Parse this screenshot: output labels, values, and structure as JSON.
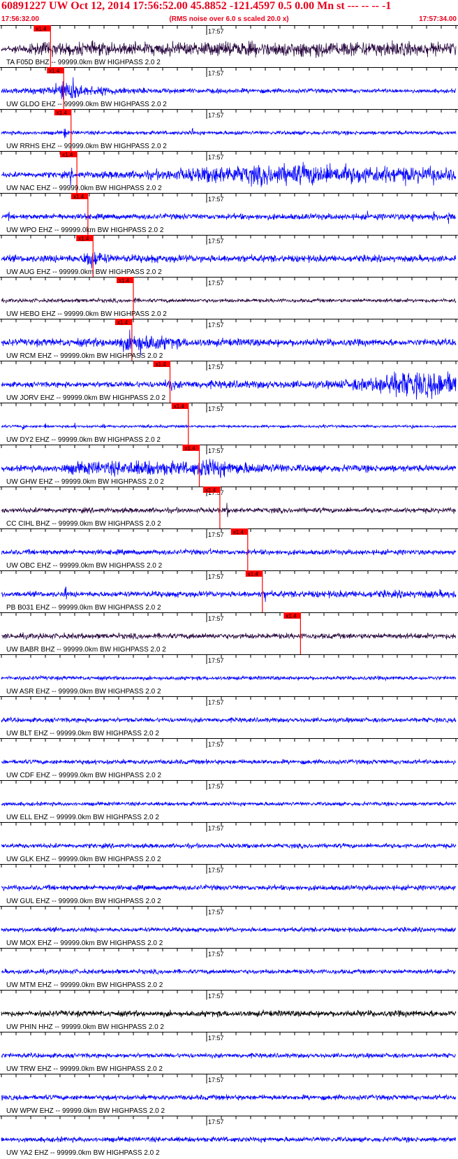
{
  "header": {
    "title": "60891227 UW Oct 12, 2014 17:56:52.00   45.8852 -121.4597  0.5 0.00 Mn st --- -- --  -1",
    "start_time": "17:56:32.00",
    "end_time": "17:57:34.00",
    "note": "(RMS noise over 6.0 s scaled 20.0 x)"
  },
  "colors": {
    "title": "#e8001c",
    "trace_blue": "#0000ff",
    "trace_dark": "#2a0a40",
    "trace_black": "#000000",
    "pick_red": "#ff0000",
    "axis": "#000000"
  },
  "chart_data": {
    "type": "seismogram",
    "x_unit": "time (UTC, 2014-10-12)",
    "x_range": [
      "17:56:32.00",
      "17:57:34.00"
    ],
    "minute_label": "17:57",
    "minute_tick": "17:57:00",
    "tick_interval_s": 2,
    "filter": "BW  HIGHPASS  2.0  2",
    "pick_label": "x1.4",
    "traces": [
      {
        "label": "TA F05D BHZ -- 99999.0km BW  HIGHPASS  2.0  2",
        "pick": "17:56:38.7",
        "color": "dark",
        "envelope": [
          [
            0,
            0.2
          ],
          [
            3,
            0.4
          ],
          [
            6,
            0.5
          ],
          [
            20,
            0.5
          ],
          [
            35,
            0.55
          ],
          [
            45,
            0.6
          ],
          [
            55,
            0.55
          ],
          [
            62,
            0.5
          ]
        ],
        "spikes": [
          [
            6.5,
            0.8
          ],
          [
            30,
            0.6
          ],
          [
            48,
            0.7
          ]
        ]
      },
      {
        "label": "UW GLDO EHZ -- 99999.0km BW  HIGHPASS  2.0  2",
        "pick": "17:56:40.5",
        "color": "blue",
        "envelope": [
          [
            0,
            0.15
          ],
          [
            7,
            0.3
          ],
          [
            8,
            0.8
          ],
          [
            10,
            0.9
          ],
          [
            11,
            0.4
          ],
          [
            20,
            0.2
          ],
          [
            62,
            0.15
          ]
        ],
        "spikes": [
          [
            8,
            0.8
          ]
        ]
      },
      {
        "label": "UW RRHS EHZ -- 99999.0km BW  HIGHPASS  2.0  2",
        "pick": "17:56:41.5",
        "color": "blue",
        "envelope": [
          [
            0,
            0.15
          ],
          [
            62,
            0.15
          ]
        ],
        "spikes": [
          [
            8.7,
            0.9
          ],
          [
            26,
            0.6
          ],
          [
            32,
            0.4
          ],
          [
            40,
            0.3
          ],
          [
            46,
            0.3
          ]
        ]
      },
      {
        "label": "UW NAC EHZ -- 99999.0km BW  HIGHPASS  2.0  2",
        "pick": "17:56:42.3",
        "color": "blue",
        "envelope": [
          [
            0,
            0.2
          ],
          [
            10,
            0.25
          ],
          [
            20,
            0.35
          ],
          [
            25,
            0.5
          ],
          [
            30,
            0.7
          ],
          [
            40,
            0.85
          ],
          [
            50,
            0.7
          ],
          [
            60,
            0.6
          ],
          [
            62,
            0.5
          ]
        ],
        "spikes": [
          [
            9.5,
            0.9
          ]
        ]
      },
      {
        "label": "UW WPO EHZ -- 99999.0km BW  HIGHPASS  2.0  2",
        "pick": "17:56:43.8",
        "color": "blue",
        "envelope": [
          [
            0,
            0.2
          ],
          [
            62,
            0.25
          ]
        ],
        "spikes": [
          [
            1,
            0.4
          ],
          [
            8,
            0.5
          ],
          [
            11.5,
            0.9
          ],
          [
            25,
            0.4
          ],
          [
            50,
            0.5
          ],
          [
            56,
            0.9
          ],
          [
            59,
            0.7
          ],
          [
            61,
            0.9
          ]
        ]
      },
      {
        "label": "UW AUG EHZ -- 99999.0km BW  HIGHPASS  2.0  2",
        "pick": "17:56:44.5",
        "color": "blue",
        "envelope": [
          [
            0,
            0.25
          ],
          [
            11,
            0.3
          ],
          [
            12,
            0.9
          ],
          [
            13,
            0.6
          ],
          [
            15,
            0.3
          ],
          [
            62,
            0.25
          ]
        ],
        "spikes": [
          [
            20.5,
            0.6
          ]
        ]
      },
      {
        "label": "UW HEBO EHZ -- 99999.0km BW  HIGHPASS  2.0  2",
        "pick": "17:56:50.0",
        "color": "dark",
        "envelope": [
          [
            0,
            0.15
          ],
          [
            62,
            0.15
          ]
        ],
        "spikes": [
          [
            18.3,
            0.4
          ]
        ]
      },
      {
        "label": "UW RCM EHZ -- 99999.0km BW  HIGHPASS  2.0  2",
        "pick": "17:56:49.8",
        "color": "blue",
        "envelope": [
          [
            0,
            0.25
          ],
          [
            15,
            0.35
          ],
          [
            17,
            0.6
          ],
          [
            18,
            0.95
          ],
          [
            21,
            0.6
          ],
          [
            25,
            0.35
          ],
          [
            30,
            0.3
          ],
          [
            62,
            0.25
          ]
        ],
        "spikes": [
          [
            18,
            1.0
          ]
        ]
      },
      {
        "label": "UW JORV EHZ -- 99999.0km BW  HIGHPASS  2.0  2",
        "pick": "17:56:55.0",
        "color": "blue",
        "envelope": [
          [
            0,
            0.2
          ],
          [
            22,
            0.25
          ],
          [
            23,
            0.5
          ],
          [
            24,
            0.3
          ],
          [
            45,
            0.3
          ],
          [
            51,
            0.6
          ],
          [
            53,
            1.0
          ],
          [
            62,
            1.0
          ]
        ],
        "spikes": []
      },
      {
        "label": "UW DY2 EHZ -- 99999.0km BW  HIGHPASS  2.0  2",
        "pick": "17:56:57.5",
        "color": "blue",
        "envelope": [
          [
            0,
            0.1
          ],
          [
            62,
            0.1
          ]
        ],
        "spikes": [
          [
            3,
            0.4
          ],
          [
            6,
            0.3
          ],
          [
            10,
            0.3
          ],
          [
            14,
            0.3
          ],
          [
            20,
            0.3
          ],
          [
            25,
            0.4
          ],
          [
            31,
            0.3
          ],
          [
            38,
            0.3
          ],
          [
            44,
            0.3
          ],
          [
            50,
            0.3
          ],
          [
            56,
            0.4
          ]
        ]
      },
      {
        "label": "UW GHW EHZ -- 99999.0km BW  HIGHPASS  2.0  2",
        "pick": "17:56:59.0",
        "color": "blue",
        "envelope": [
          [
            0,
            0.2
          ],
          [
            8,
            0.3
          ],
          [
            10,
            0.5
          ],
          [
            20,
            0.6
          ],
          [
            26,
            0.5
          ],
          [
            28,
            0.8
          ],
          [
            32,
            0.5
          ],
          [
            40,
            0.3
          ],
          [
            62,
            0.25
          ]
        ],
        "spikes": [
          [
            27.5,
            0.9
          ],
          [
            29,
            0.8
          ]
        ]
      },
      {
        "label": "CC CIHL BHZ -- 99999.0km BW  HIGHPASS  2.0  2",
        "pick": "17:57:01.8",
        "color": "dark",
        "envelope": [
          [
            0,
            0.2
          ],
          [
            62,
            0.2
          ]
        ],
        "spikes": [
          [
            30.8,
            0.7
          ]
        ]
      },
      {
        "label": "UW OBC EHZ -- 99999.0km BW  HIGHPASS  2.0  2",
        "pick": "17:57:05.6",
        "color": "blue",
        "envelope": [
          [
            0,
            0.2
          ],
          [
            62,
            0.2
          ]
        ],
        "spikes": [
          [
            28.5,
            0.5
          ],
          [
            36,
            0.4
          ]
        ]
      },
      {
        "label": "PB B031 EHZ -- 99999.0km BW  HIGHPASS  2.0  2",
        "pick": "17:57:07.6",
        "color": "blue",
        "envelope": [
          [
            0,
            0.2
          ],
          [
            38,
            0.25
          ],
          [
            58,
            0.3
          ],
          [
            62,
            0.3
          ]
        ],
        "spikes": [
          [
            8.8,
            0.9
          ],
          [
            23,
            0.5
          ],
          [
            36,
            0.7
          ]
        ]
      },
      {
        "label": "UW BABR BHZ -- 99999.0km BW  HIGHPASS  2.0  2",
        "pick": "17:57:12.8",
        "color": "dark",
        "envelope": [
          [
            0,
            0.22
          ],
          [
            62,
            0.22
          ]
        ],
        "spikes": []
      },
      {
        "label": "UW ASR EHZ -- 99999.0km BW  HIGHPASS  2.0  2",
        "pick": null,
        "color": "blue",
        "envelope": [
          [
            0,
            0.15
          ],
          [
            62,
            0.15
          ]
        ],
        "spikes": []
      },
      {
        "label": "UW BLT EHZ -- 99999.0km BW  HIGHPASS  2.0  2",
        "pick": null,
        "color": "blue",
        "envelope": [
          [
            0,
            0.18
          ],
          [
            62,
            0.18
          ]
        ],
        "spikes": []
      },
      {
        "label": "UW CDF EHZ -- 99999.0km BW  HIGHPASS  2.0  2",
        "pick": null,
        "color": "blue",
        "envelope": [
          [
            0,
            0.18
          ],
          [
            62,
            0.18
          ]
        ],
        "spikes": []
      },
      {
        "label": "UW ELL EHZ -- 99999.0km BW  HIGHPASS  2.0  2",
        "pick": null,
        "color": "blue",
        "envelope": [
          [
            0,
            0.15
          ],
          [
            62,
            0.15
          ]
        ],
        "spikes": []
      },
      {
        "label": "UW GLK EHZ -- 99999.0km BW  HIGHPASS  2.0  2",
        "pick": null,
        "color": "blue",
        "envelope": [
          [
            0,
            0.18
          ],
          [
            62,
            0.18
          ]
        ],
        "spikes": []
      },
      {
        "label": "UW GUL EHZ -- 99999.0km BW  HIGHPASS  2.0  2",
        "pick": null,
        "color": "blue",
        "envelope": [
          [
            0,
            0.2
          ],
          [
            62,
            0.2
          ]
        ],
        "spikes": []
      },
      {
        "label": "UW MOX EHZ -- 99999.0km BW  HIGHPASS  2.0  2",
        "pick": null,
        "color": "blue",
        "envelope": [
          [
            0,
            0.18
          ],
          [
            62,
            0.18
          ]
        ],
        "spikes": []
      },
      {
        "label": "UW MTM EHZ -- 99999.0km BW  HIGHPASS  2.0  2",
        "pick": null,
        "color": "blue",
        "envelope": [
          [
            0,
            0.18
          ],
          [
            62,
            0.18
          ]
        ],
        "spikes": []
      },
      {
        "label": "UW PHIN HHZ -- 99999.0km BW  HIGHPASS  2.0  2",
        "pick": null,
        "color": "black",
        "envelope": [
          [
            0,
            0.22
          ],
          [
            62,
            0.25
          ]
        ],
        "spikes": []
      },
      {
        "label": "UW TRW EHZ -- 99999.0km BW  HIGHPASS  2.0  2",
        "pick": null,
        "color": "blue",
        "envelope": [
          [
            0,
            0.18
          ],
          [
            62,
            0.18
          ]
        ],
        "spikes": []
      },
      {
        "label": "UW WPW EHZ -- 99999.0km BW  HIGHPASS  2.0  2",
        "pick": null,
        "color": "blue",
        "envelope": [
          [
            0,
            0.2
          ],
          [
            62,
            0.2
          ]
        ],
        "spikes": []
      },
      {
        "label": "UW YA2 EHZ -- 99999.0km BW  HIGHPASS  2.0  2",
        "pick": null,
        "color": "blue",
        "envelope": [
          [
            0,
            0.2
          ],
          [
            62,
            0.2
          ]
        ],
        "spikes": []
      }
    ]
  }
}
